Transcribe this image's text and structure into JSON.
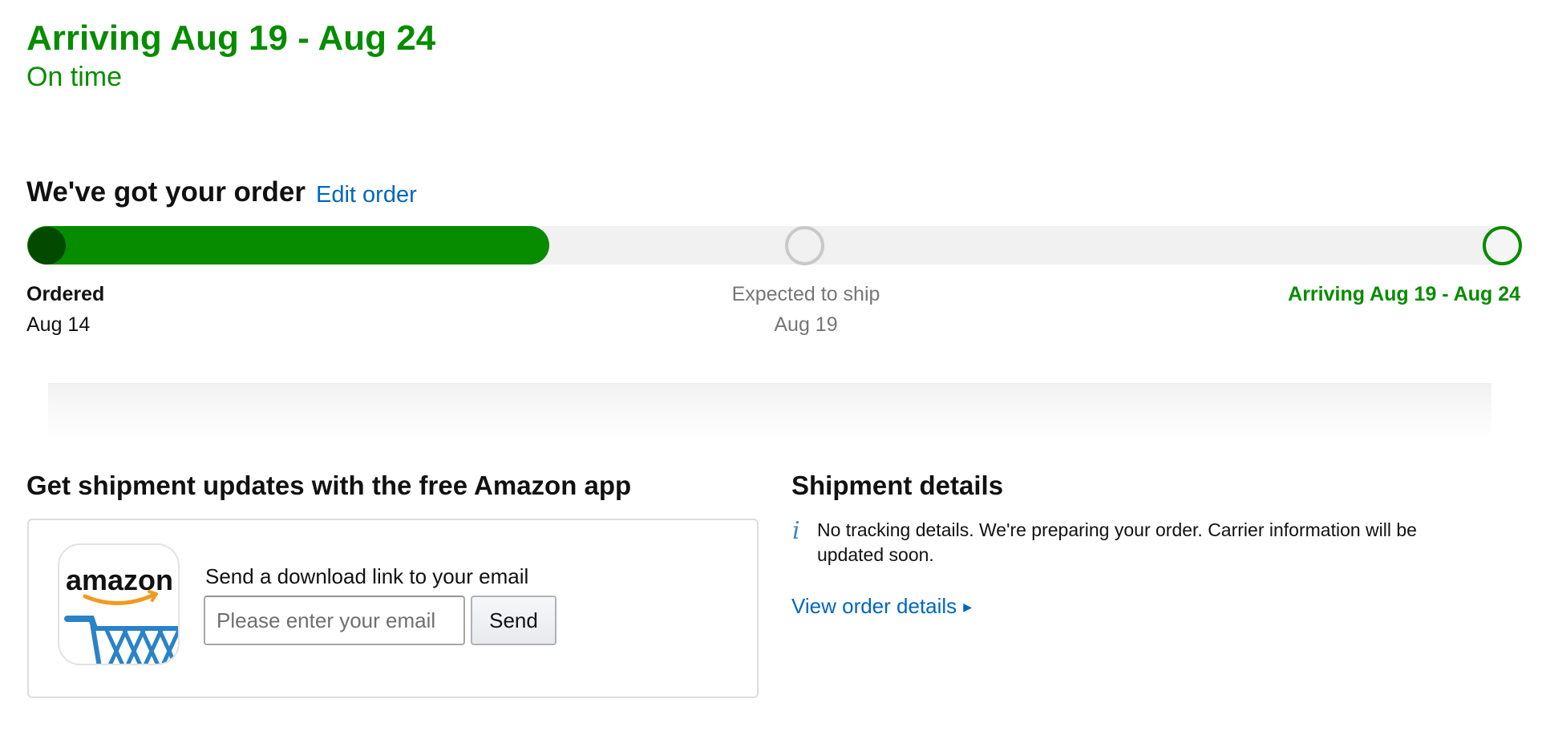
{
  "arrival": {
    "title": "Arriving Aug 19 - Aug 24",
    "status": "On time",
    "color": "#078c00"
  },
  "order_status": {
    "heading": "We've got your order",
    "edit_link": "Edit order",
    "progress_fraction": 0.35,
    "steps": [
      {
        "label": "Ordered",
        "date": "Aug 14",
        "state": "complete"
      },
      {
        "label": "Expected to ship",
        "date": "Aug 19",
        "state": "pending"
      },
      {
        "label": "Arriving Aug 19 - Aug 24",
        "date": "",
        "state": "destination"
      }
    ]
  },
  "app_promo": {
    "heading": "Get shipment updates with the free Amazon app",
    "icon": "amazon-app-icon",
    "logo_text": "amazon",
    "send_label": "Send a download link to your email",
    "email_placeholder": "Please enter your email",
    "email_value": "",
    "send_button": "Send"
  },
  "shipment": {
    "heading": "Shipment details",
    "info_icon": "info-icon",
    "message": "No tracking details. We're preparing your order. Carrier information will be updated soon.",
    "view_link": "View order details",
    "link_color": "#0066c0"
  }
}
